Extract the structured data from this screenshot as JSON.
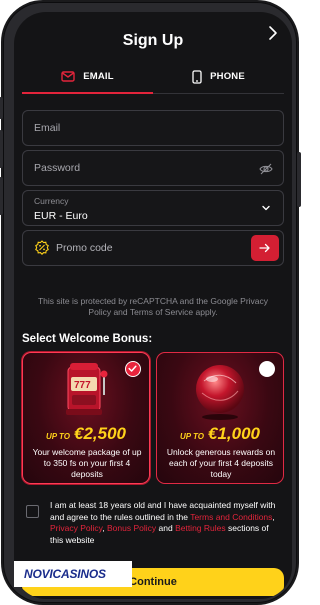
{
  "header": {
    "title": "Sign Up"
  },
  "tabs": [
    {
      "label": "EMAIL",
      "active": true,
      "icon": "mail-icon"
    },
    {
      "label": "PHONE",
      "active": false,
      "icon": "phone-icon"
    }
  ],
  "form": {
    "email_placeholder": "Email",
    "password_placeholder": "Password",
    "currency_label": "Currency",
    "currency_value": "EUR - Euro",
    "promo_placeholder": "Promo code"
  },
  "recaptcha_text": "This site is protected by reCAPTCHA and the Google Privacy Policy and Terms of Service apply.",
  "bonus": {
    "title": "Select Welcome Bonus:",
    "cards": [
      {
        "prefix": "UP TO",
        "amount": "€2,500",
        "description": "Your welcome package of up to 350 fs on your first 4 deposits",
        "selected": true
      },
      {
        "prefix": "UP TO",
        "amount": "€1,000",
        "description": "Unlock generous rewards on each of your first 4 deposits today",
        "selected": false
      }
    ]
  },
  "terms": {
    "text1": "I am at least 18 years old and I have acquainted myself with and agree to the rules outlined in the ",
    "link1": "Terms and Conditions",
    "sep1": ", ",
    "link2": "Privacy Policy",
    "sep2": ", ",
    "link3": "Bonus Policy",
    "sep3": " and ",
    "link4": "Betting Rules",
    "text2": " sections of this website"
  },
  "continue_label": "Continue",
  "watermark": {
    "part1": "NOVI",
    "part2": "CASINOS"
  },
  "colors": {
    "accent": "#e3243b",
    "gold": "#ffd21a",
    "background": "#141416"
  }
}
